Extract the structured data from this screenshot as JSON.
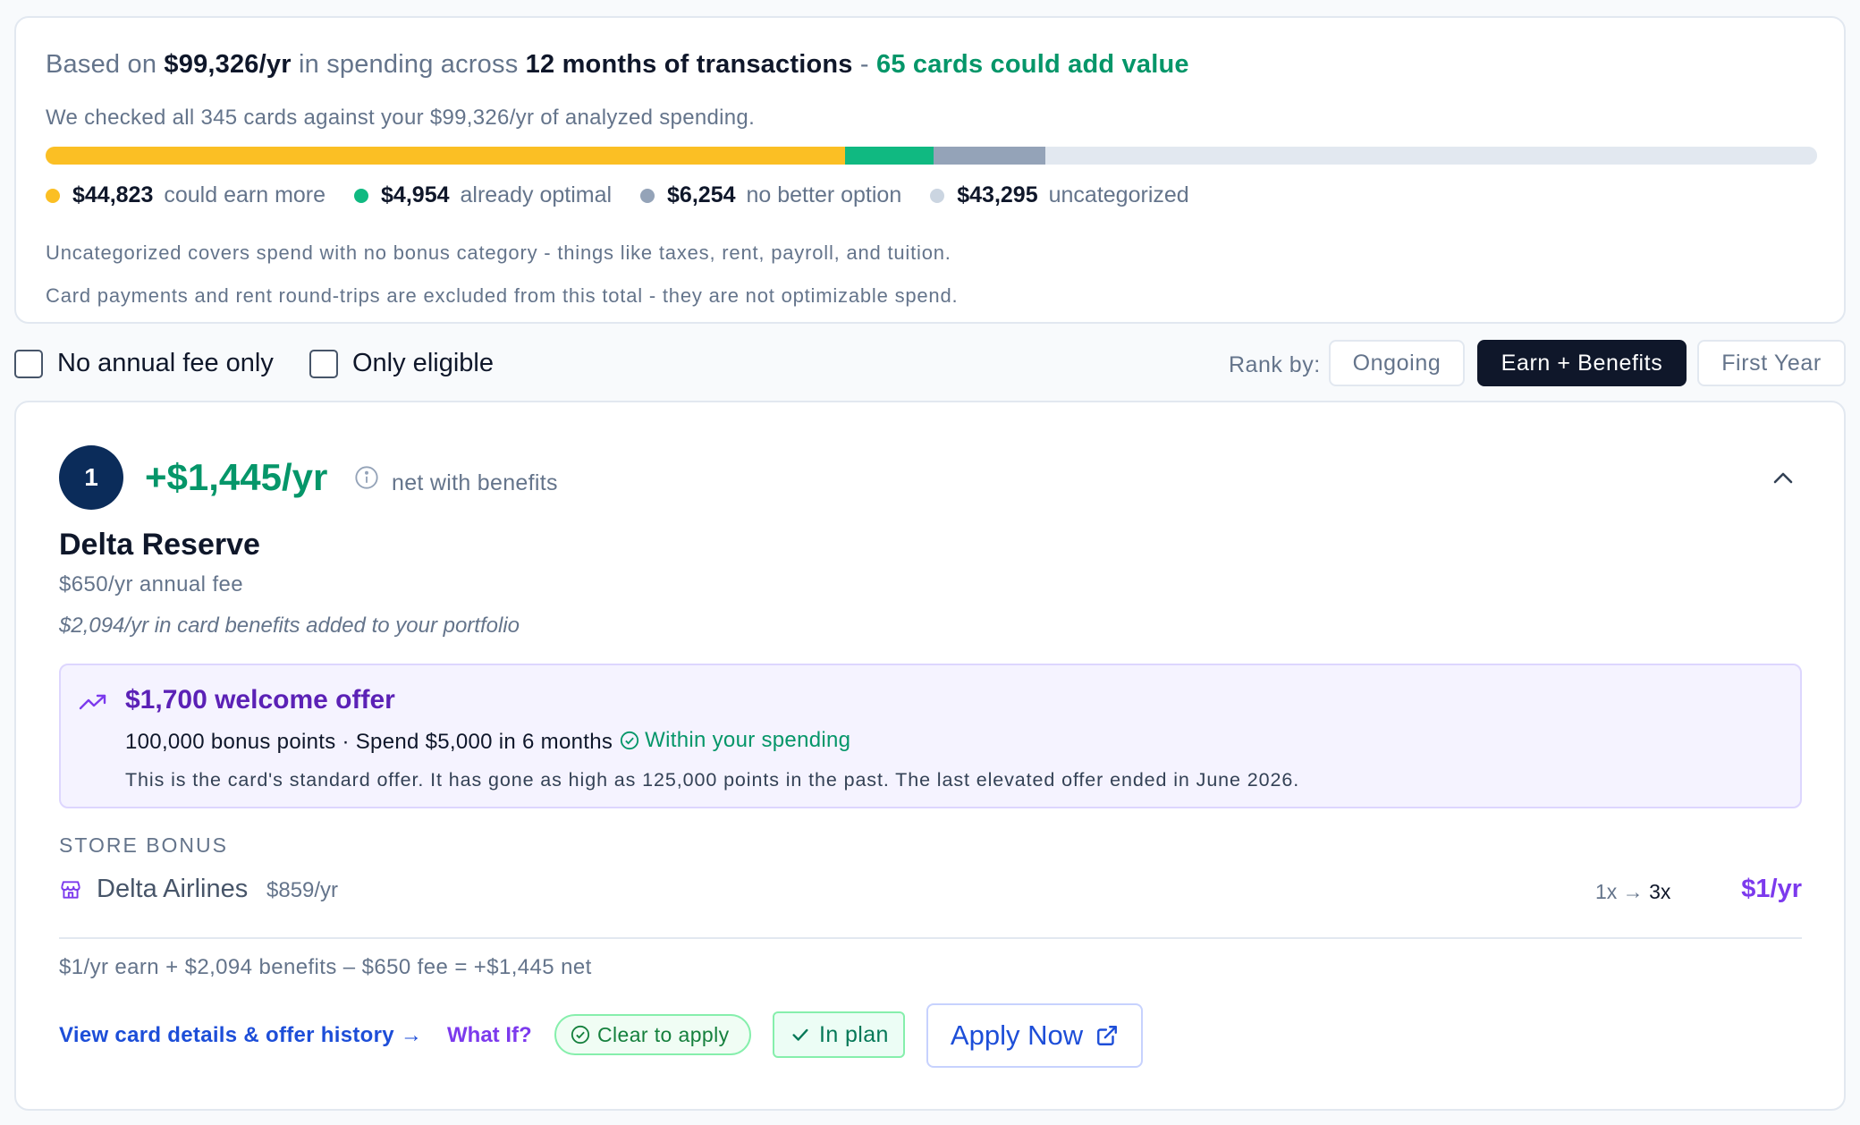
{
  "summary": {
    "prefix": "Based on ",
    "spend": "$99,326/yr",
    "mid": " in spending across ",
    "months": "12 months of transactions",
    "dash": " - ",
    "cards_add": "65 cards could add value",
    "checked": "We checked all 345 cards against your $99,326/yr of analyzed spending.",
    "segments": [
      {
        "amount": "$44,823",
        "label": "could earn more",
        "color": "#fbbf24",
        "fraction": 0.4513
      },
      {
        "amount": "$4,954",
        "label": "already optimal",
        "color": "#10b981",
        "fraction": 0.0499
      },
      {
        "amount": "$6,254",
        "label": "no better option",
        "color": "#94a3b8",
        "fraction": 0.063
      },
      {
        "amount": "$43,295",
        "label": "uncategorized",
        "color": "#e2e8f0",
        "fraction": 0.4358
      }
    ],
    "note1": "Uncategorized covers spend with no bonus category - things like taxes, rent, payroll, and tuition.",
    "note2": "Card payments and rent round-trips are excluded from this total - they are not optimizable spend."
  },
  "filters": {
    "no_fee": "No annual fee only",
    "eligible": "Only eligible",
    "rank_by": "Rank by:",
    "options": [
      "Ongoing",
      "Earn + Benefits",
      "First Year"
    ],
    "active": "Earn + Benefits"
  },
  "card": {
    "rank": "1",
    "net_value": "+$1,445/yr",
    "net_label": "net with benefits",
    "name": "Delta Reserve",
    "fee": "$650/yr annual fee",
    "benefits": "$2,094/yr in card benefits added to your portfolio",
    "offer": {
      "title": "$1,700 welcome offer",
      "details": "100,000 bonus points · Spend $5,000 in 6 months",
      "within": "Within your spending",
      "history": "This is the card's standard offer. It has gone as high as 125,000 points in the past. The last elevated offer ended in June 2026."
    },
    "store_bonus_heading": "STORE BONUS",
    "store": {
      "name": "Delta Airlines",
      "spend": "$859/yr",
      "from": "1x →",
      "to": "3x",
      "value": "$1/yr"
    },
    "formula": "$1/yr earn + $2,094 benefits – $650 fee = +$1,445 net",
    "actions": {
      "details_link": "View card details & offer history →",
      "what_if": "What If?",
      "clear": "Clear to apply",
      "in_plan": "In plan",
      "apply": "Apply Now"
    }
  },
  "colors": {
    "green": "#059669",
    "purple": "#7c3aed",
    "navy": "#0b2c5a",
    "blue": "#1d4ed8"
  }
}
